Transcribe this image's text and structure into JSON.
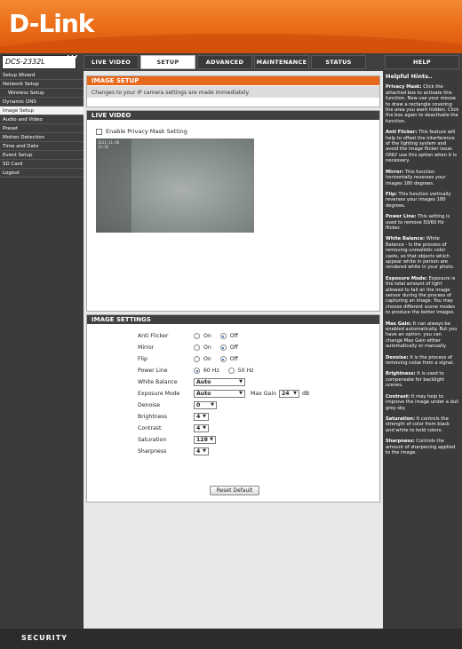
{
  "brand": {
    "logo": "D-Link",
    "model": "DCS-2332L",
    "footer": "SECURITY"
  },
  "nav": {
    "tabs": [
      "LIVE VIDEO",
      "SETUP",
      "ADVANCED",
      "MAINTENANCE",
      "STATUS",
      "HELP"
    ],
    "active": "SETUP"
  },
  "sidebar": {
    "items": [
      "Setup Wizard",
      "Network Setup",
      "Wireless Setup",
      "Dynamic DNS",
      "Image Setup",
      "Audio and Video",
      "Preset",
      "Motion Detection",
      "Time and Date",
      "Event Setup",
      "SD Card",
      "Logout"
    ],
    "active": "Image Setup"
  },
  "image_setup": {
    "title": "IMAGE SETUP",
    "description": "Changes to your IP camera settings are made immediately."
  },
  "live_video": {
    "title": "LIVE VIDEO",
    "privacy_label": "Enable Privacy Mask Setting",
    "privacy_checked": false,
    "timestamp": [
      "2013-11-26",
      "15:31"
    ]
  },
  "settings": {
    "title": "IMAGE SETTINGS",
    "anti_flicker": {
      "label": "Anti Flicker",
      "on": "On",
      "off": "Off",
      "value": "Off"
    },
    "mirror": {
      "label": "Mirror",
      "on": "On",
      "off": "Off",
      "value": "Off"
    },
    "flip": {
      "label": "Flip",
      "on": "On",
      "off": "Off",
      "value": "Off"
    },
    "power_line": {
      "label": "Power Line",
      "opt1": "60 Hz",
      "opt2": "50 Hz",
      "value": "60 Hz"
    },
    "white_balance": {
      "label": "White Balance",
      "value": "Auto"
    },
    "exposure_mode": {
      "label": "Exposure Mode",
      "value": "Auto",
      "max_gain_label": "Max Gain",
      "max_gain": "24",
      "unit": "dB"
    },
    "denoise": {
      "label": "Denoise",
      "value": "0"
    },
    "brightness": {
      "label": "Brightness",
      "value": "4"
    },
    "contrast": {
      "label": "Contrast",
      "value": "4"
    },
    "saturation": {
      "label": "Saturation",
      "value": "128"
    },
    "sharpness": {
      "label": "Sharpness",
      "value": "4"
    },
    "reset_label": "Reset Default"
  },
  "hints": {
    "title": "Helpful Hints..",
    "items": [
      {
        "term": "Privacy Mask:",
        "text": "Click the attached box to activate this function. Now use your mouse to draw a rectangle covering the area you want hidden. Click the box again to deactivate the function."
      },
      {
        "term": "Anti Flicker:",
        "text": "This feature will help to offset the interference of the lighting system and avoid the image flicker issue. ONLY use this option when it is necessary."
      },
      {
        "term": "Mirror:",
        "text": "This function horizontally reverses your images 180 degrees."
      },
      {
        "term": "Flip:",
        "text": "This function vertically reverses your images 180 degrees."
      },
      {
        "term": "Power Line:",
        "text": "This setting is used to remove 50/60 Hz flicker."
      },
      {
        "term": "White Balance:",
        "text": "White Balance - Is the process of removing unrealistic color casts, so that objects which appear white in person are rendered white in your photo."
      },
      {
        "term": "Exposure Mode:",
        "text": "Exposure is the total amount of light allowed to fall on the image sensor during the process of capturing an image. You may choose different scene modes to produce the better images."
      },
      {
        "term": "Max Gain:",
        "text": "It can always be enabled automatically. But you have an option- you can change Max Gain either automatically or manually."
      },
      {
        "term": "Denoise:",
        "text": "It is the process of removing noise from a signal."
      },
      {
        "term": "Brightness:",
        "text": "It is used to compensate for backlight scenes."
      },
      {
        "term": "Contrast:",
        "text": "It may help to improve the image under a dull grey sky."
      },
      {
        "term": "Saturation:",
        "text": "It controls the strength of color from black and white to bold colors."
      },
      {
        "term": "Sharpness:",
        "text": "Controls the amount of sharpening applied to the image."
      }
    ]
  }
}
